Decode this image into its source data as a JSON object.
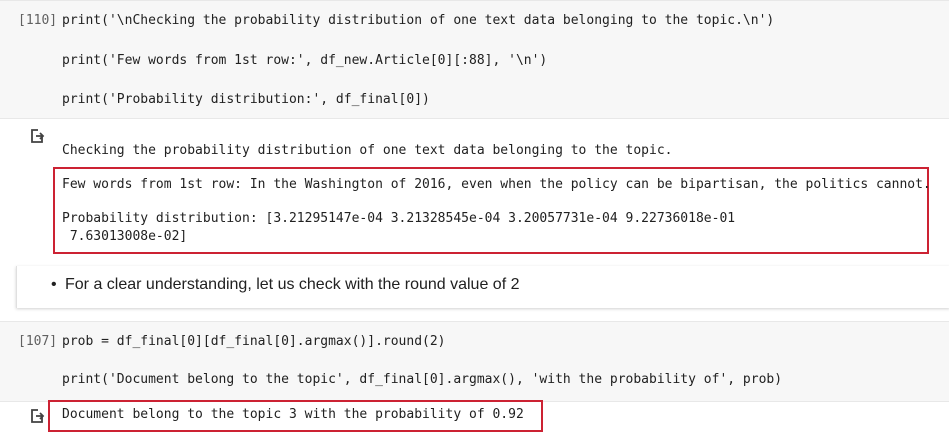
{
  "cells": {
    "cell_110": {
      "exec_count": "[110]",
      "lines": [
        "print('\\nChecking the probability distribution of one text data belonging to the topic.\\n')",
        "print('Few words from 1st row:', df_new.Article[0][:88], '\\n')",
        "print('Probability distribution:', df_final[0])"
      ],
      "output": {
        "line1": "Checking the probability distribution of one text data belonging to the topic.",
        "line2": "Few words from 1st row: In the Washington of 2016, even when the policy can be bipartisan, the politics cannot.",
        "line3": "Probability distribution: [3.21295147e-04 3.21328545e-04 3.20057731e-04 9.22736018e-01",
        "line4": " 7.63013008e-02]"
      }
    },
    "markdown": {
      "bullet": "•",
      "text": "For a clear understanding, let us check with the round value of 2"
    },
    "cell_107": {
      "exec_count": "[107]",
      "lines": [
        "prob = df_final[0][df_final[0].argmax()].round(2)",
        "print('Document belong to the topic', df_final[0].argmax(), 'with the probability of', prob)"
      ],
      "output": {
        "line1": "Document belong to the topic 3 with the probability of 0.92"
      }
    }
  },
  "colors": {
    "cell_background": "#f7f7f7",
    "highlight_border": "#cc2233",
    "string_literal": "#a31515"
  }
}
